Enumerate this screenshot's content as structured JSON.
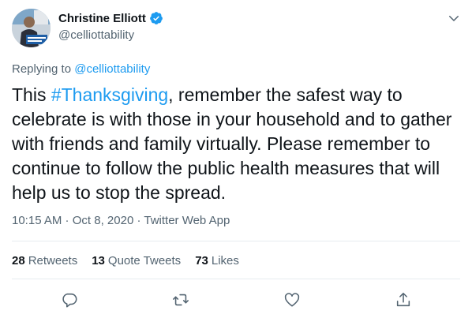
{
  "author": {
    "display_name": "Christine Elliott",
    "handle": "@celliottability",
    "verified": true
  },
  "reply": {
    "prefix": "Replying to ",
    "target": "@celliottability"
  },
  "tweet": {
    "text_before": "This ",
    "hashtag": "#Thanksgiving",
    "text_after": ", remember the safest way to celebrate is with those in your household and to gather with friends and family virtually.  Please remember to continue to follow the public health measures that will help us to stop the spread."
  },
  "meta": {
    "time": "10:15 AM",
    "sep1": " · ",
    "date": "Oct 8, 2020",
    "sep2": " · ",
    "source": "Twitter Web App"
  },
  "stats": {
    "retweets_count": "28",
    "retweets_label": "Retweets",
    "quotes_count": "13",
    "quotes_label": "Quote Tweets",
    "likes_count": "73",
    "likes_label": "Likes"
  },
  "icons": {
    "verified": "verified-badge-icon",
    "caret": "chevron-down-icon",
    "reply": "reply-icon",
    "retweet": "retweet-icon",
    "like": "heart-icon",
    "share": "share-icon"
  },
  "colors": {
    "accent": "#1d9bf0",
    "text": "#0f1419",
    "secondary": "#536471",
    "divider": "#e6ecf0"
  }
}
